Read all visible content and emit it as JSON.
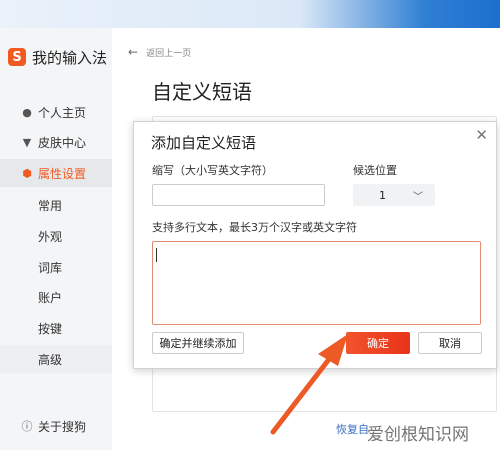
{
  "brand": {
    "name": "我的输入法",
    "logo_glyph": "S",
    "logo_color": "#f05a22"
  },
  "sidebar": {
    "items": [
      {
        "label": "个人主页",
        "icon": "person-icon"
      },
      {
        "label": "皮肤中心",
        "icon": "shirt-icon"
      },
      {
        "label": "属性设置",
        "icon": "settings-hex-icon",
        "active": true
      }
    ],
    "sub_items": [
      "常用",
      "外观",
      "词库",
      "账户",
      "按键",
      "高级"
    ],
    "selected_sub": "高级",
    "about": {
      "label": "关于搜狗",
      "icon": "info-icon"
    }
  },
  "main": {
    "back_label": "返回上一页",
    "title": "自定义短语",
    "restore_link": "恢复自"
  },
  "dialog": {
    "title": "添加自定义短语",
    "abbr_label": "缩写（大小写英文字符）",
    "abbr_value": "",
    "position_label": "候选位置",
    "position_value": "1",
    "content_label": "支持多行文本，最长3万个汉字或英文字符",
    "content_value": "",
    "continue_button": "确定并继续添加",
    "ok_button": "确定",
    "cancel_button": "取消"
  },
  "watermark": "爱创根知识网",
  "colors": {
    "accent": "#f05a22",
    "annotation_arrow": "#ec5a25",
    "top_gradient_end": "#1c6fce"
  }
}
